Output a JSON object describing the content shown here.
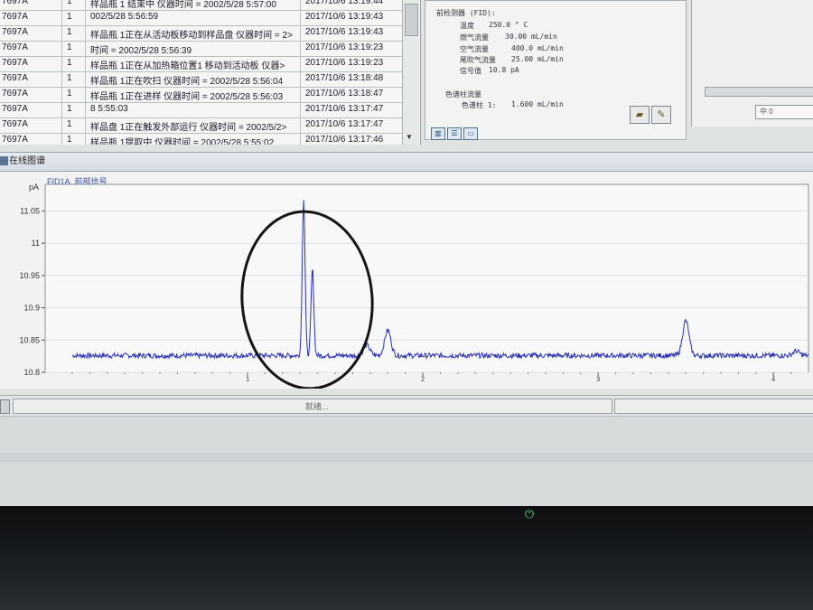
{
  "log_table": {
    "rows": [
      {
        "id": "7697A",
        "n": "1",
        "msg": "样品瓶 1 结束中 仪器时间 = 2002/5/28 5:57:00",
        "time": "2017/10/6 13:19:44"
      },
      {
        "id": "7697A",
        "n": "1",
        "msg": "002/5/28 5:56:59",
        "time": "2017/10/6 13:19:43"
      },
      {
        "id": "7697A",
        "n": "1",
        "msg": "样品瓶 1正在从活动板移动到样品盘 仪器时间 = 2>",
        "time": "2017/10/6 13:19:43"
      },
      {
        "id": "7697A",
        "n": "1",
        "msg": "时间 = 2002/5/28 5:56:39",
        "time": "2017/10/6 13:19:23"
      },
      {
        "id": "7697A",
        "n": "1",
        "msg": "样品瓶 1正在从加热箱位置1 移动到活动板 仪器>",
        "time": "2017/10/6 13:19:23"
      },
      {
        "id": "7697A",
        "n": "1",
        "msg": "样品瓶 1正在吹扫 仪器时间 = 2002/5/28 5:56:04",
        "time": "2017/10/6 13:18:48"
      },
      {
        "id": "7697A",
        "n": "1",
        "msg": "样品瓶 1正在进样 仪器时间 = 2002/5/28 5:56:03",
        "time": "2017/10/6 13:18:47"
      },
      {
        "id": "7697A",
        "n": "1",
        "msg": "8 5:55:03",
        "time": "2017/10/6 13:17:47"
      },
      {
        "id": "7697A",
        "n": "1",
        "msg": "样品盘 1正在触发外部运行 仪器时间 = 2002/5/2>",
        "time": "2017/10/6 13:17:47"
      },
      {
        "id": "7697A",
        "n": "1",
        "msg": "样品瓶 1提取中 仪器时间 = 2002/5/28 5:55:02",
        "time": "2017/10/6 13:17:46"
      }
    ]
  },
  "detector": {
    "header": "前检测器 (FID):",
    "temp_label": "温度",
    "temp_value": "250.0 ° C",
    "fuel_label": "燃气流量",
    "fuel_value": "30.00 mL/min",
    "air_label": "空气流量",
    "air_value": "400.0 mL/min",
    "makeup_label": "尾吹气流量",
    "makeup_value": "25.00 mL/min",
    "signal_label": "信号值",
    "signal_value": "10.8 pA",
    "column_header": "色谱柱流量",
    "column_label": "色谱柱 1:",
    "column_value": "1.600 mL/min"
  },
  "right_panel": {
    "field": "中 0"
  },
  "online": {
    "title": "在线图谱",
    "status_text": "就绪..."
  },
  "chart_data": {
    "type": "line",
    "title": "FID1A, 前部信号",
    "ylabel": "pA",
    "xlim": [
      0,
      4.2
    ],
    "ylim": [
      10.8,
      11.08
    ],
    "x_ticks": [
      "1",
      "2",
      "3",
      "4"
    ],
    "y_ticks": [
      "11.05",
      "11",
      "10.95",
      "10.9",
      "10.85",
      "10.8"
    ],
    "series": [
      {
        "color": "#2a2fb0",
        "baseline": 10.826,
        "peaks": [
          {
            "x": 1.32,
            "y": 11.07
          },
          {
            "x": 1.37,
            "y": 10.96
          },
          {
            "x": 1.68,
            "y": 10.842
          },
          {
            "x": 1.8,
            "y": 10.865
          },
          {
            "x": 3.5,
            "y": 10.88
          },
          {
            "x": 4.13,
            "y": 10.833
          }
        ]
      }
    ],
    "grid": true
  },
  "colors": {
    "trace": "#2a2fb0",
    "annotation_circle": "#151515",
    "power_led": "#58d36c"
  },
  "icons": {
    "power": "power-icon",
    "eraser": "eraser-icon",
    "edit": "edit-icon"
  }
}
